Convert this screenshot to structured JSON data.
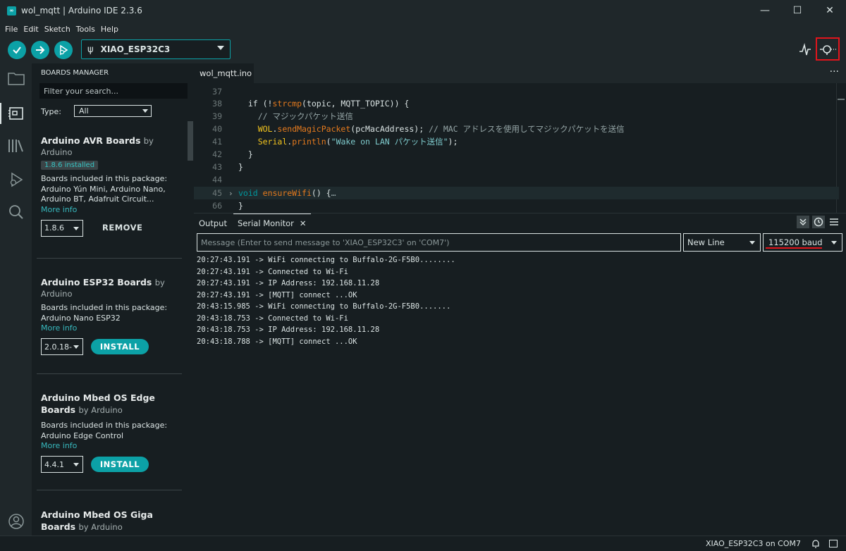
{
  "window": {
    "title": "wol_mqtt | Arduino IDE 2.3.6",
    "logo_text": "∞",
    "minimize": "—",
    "maximize": "☐",
    "close": "✕"
  },
  "menu": [
    "File",
    "Edit",
    "Sketch",
    "Tools",
    "Help"
  ],
  "toolbar": {
    "board_name": "XIAO_ESP32C3",
    "usb_glyph": "ψ"
  },
  "sidebar": {
    "title": "BOARDS MANAGER",
    "search_placeholder": "Filter your search...",
    "type_label": "Type:",
    "type_value": "All",
    "boards": [
      {
        "title": "Arduino AVR Boards",
        "by": "by",
        "author": "Arduino",
        "installed_badge": "1.8.6 installed",
        "desc_intro": "Boards included in this package:",
        "desc_boards": "Arduino Yún Mini, Arduino Nano, Arduino BT, Adafruit Circuit...",
        "more_info": "More info",
        "version": "1.8.6",
        "action": "REMOVE"
      },
      {
        "title": "Arduino ESP32 Boards",
        "by": "by",
        "author": "Arduino",
        "desc_intro": "Boards included in this package:",
        "desc_boards": "Arduino Nano ESP32",
        "more_info": "More info",
        "version": "2.0.18-",
        "action": "INSTALL"
      },
      {
        "title": "Arduino Mbed OS Edge Boards",
        "by": "by Arduino",
        "desc_intro": "Boards included in this package:",
        "desc_boards": "Arduino Edge Control",
        "more_info": "More info",
        "version": "4.4.1",
        "action": "INSTALL"
      },
      {
        "title": "Arduino Mbed OS Giga Boards",
        "by": "by Arduino"
      }
    ]
  },
  "editor": {
    "tab": "wol_mqtt.ino",
    "more": "···",
    "fold_marker": "›",
    "lines": [
      {
        "n": "37",
        "parts": [
          {
            "t": "",
            "c": ""
          }
        ]
      },
      {
        "n": "38",
        "parts": [
          {
            "t": "  if (!",
            "c": ""
          },
          {
            "t": "strcmp",
            "c": "k-fn"
          },
          {
            "t": "(topic, MQTT_TOPIC)) {",
            "c": ""
          }
        ]
      },
      {
        "n": "39",
        "parts": [
          {
            "t": "    // マジックパケット送信",
            "c": "k-cm"
          }
        ]
      },
      {
        "n": "40",
        "parts": [
          {
            "t": "    ",
            "c": ""
          },
          {
            "t": "WOL",
            "c": "k-obj"
          },
          {
            "t": ".",
            "c": ""
          },
          {
            "t": "sendMagicPacket",
            "c": "k-fn"
          },
          {
            "t": "(pcMacAddress); ",
            "c": ""
          },
          {
            "t": "// MAC アドレスを使用してマジックパケットを送信",
            "c": "k-cm"
          }
        ]
      },
      {
        "n": "41",
        "parts": [
          {
            "t": "    ",
            "c": ""
          },
          {
            "t": "Serial",
            "c": "k-obj"
          },
          {
            "t": ".",
            "c": ""
          },
          {
            "t": "println",
            "c": "k-fn"
          },
          {
            "t": "(",
            "c": ""
          },
          {
            "t": "\"Wake on LAN パケット送信\"",
            "c": "k-str"
          },
          {
            "t": ");",
            "c": ""
          }
        ]
      },
      {
        "n": "42",
        "parts": [
          {
            "t": "  }",
            "c": ""
          }
        ]
      },
      {
        "n": "43",
        "parts": [
          {
            "t": "}",
            "c": ""
          }
        ]
      },
      {
        "n": "44",
        "parts": [
          {
            "t": "",
            "c": ""
          }
        ]
      },
      {
        "n": "45",
        "parts": [
          {
            "t": "void",
            "c": "k-kw"
          },
          {
            "t": " ",
            "c": ""
          },
          {
            "t": "ensureWifi",
            "c": "k-fn"
          },
          {
            "t": "() {",
            "c": ""
          },
          {
            "t": "…",
            "c": "k-cm"
          }
        ]
      },
      {
        "n": "66",
        "parts": [
          {
            "t": "}",
            "c": ""
          }
        ]
      }
    ]
  },
  "output": {
    "tab_output": "Output",
    "tab_serial": "Serial Monitor",
    "tab_close": "✕",
    "message_placeholder": "Message (Enter to send message to 'XIAO_ESP32C3' on 'COM7')",
    "line_ending": "New Line",
    "baud": "115200 baud",
    "lines": [
      "20:27:43.191 -> WiFi connecting to Buffalo-2G-F5B0........",
      "20:27:43.191 -> Connected to Wi-Fi",
      "20:27:43.191 -> IP Address: 192.168.11.28",
      "20:27:43.191 -> [MQTT] connect ...OK",
      "20:43:15.985 -> WiFi connecting to Buffalo-2G-F5B0.......",
      "20:43:18.753 -> Connected to Wi-Fi",
      "20:43:18.753 -> IP Address: 192.168.11.28",
      "20:43:18.788 -> [MQTT] connect ...OK"
    ]
  },
  "status": {
    "board_port": "XIAO_ESP32C3 on COM7"
  },
  "colors": {
    "accent": "#0ca1a6",
    "highlight_red": "#e0151c",
    "background": "#171e21",
    "panel": "#1f272a"
  }
}
